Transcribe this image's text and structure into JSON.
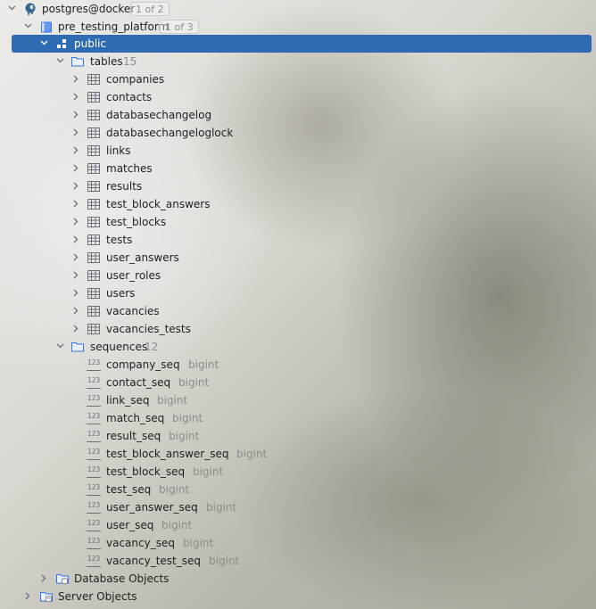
{
  "tree": {
    "connection": {
      "label": "postgres@docker",
      "badge": "1 of 2"
    },
    "database": {
      "label": "pre_testing_platform",
      "badge": "1 of 3"
    },
    "schema": {
      "label": "public"
    },
    "tables_folder": {
      "label": "tables",
      "count": "15"
    },
    "tables": [
      "companies",
      "contacts",
      "databasechangelog",
      "databasechangeloglock",
      "links",
      "matches",
      "results",
      "test_block_answers",
      "test_blocks",
      "tests",
      "user_answers",
      "user_roles",
      "users",
      "vacancies",
      "vacancies_tests"
    ],
    "sequences_folder": {
      "label": "sequences",
      "count": "12"
    },
    "sequences": [
      {
        "name": "company_seq",
        "type": "bigint"
      },
      {
        "name": "contact_seq",
        "type": "bigint"
      },
      {
        "name": "link_seq",
        "type": "bigint"
      },
      {
        "name": "match_seq",
        "type": "bigint"
      },
      {
        "name": "result_seq",
        "type": "bigint"
      },
      {
        "name": "test_block_answer_seq",
        "type": "bigint"
      },
      {
        "name": "test_block_seq",
        "type": "bigint"
      },
      {
        "name": "test_seq",
        "type": "bigint"
      },
      {
        "name": "user_answer_seq",
        "type": "bigint"
      },
      {
        "name": "user_seq",
        "type": "bigint"
      },
      {
        "name": "vacancy_seq",
        "type": "bigint"
      },
      {
        "name": "vacancy_test_seq",
        "type": "bigint"
      }
    ],
    "database_objects": {
      "label": "Database Objects"
    },
    "server_objects": {
      "label": "Server Objects"
    },
    "sequence_icon_text": "123"
  },
  "colors": {
    "selection": "#2f6bb3",
    "folder": "#3574f0",
    "hint": "#8c8c8c",
    "text": "#1e1f22"
  }
}
